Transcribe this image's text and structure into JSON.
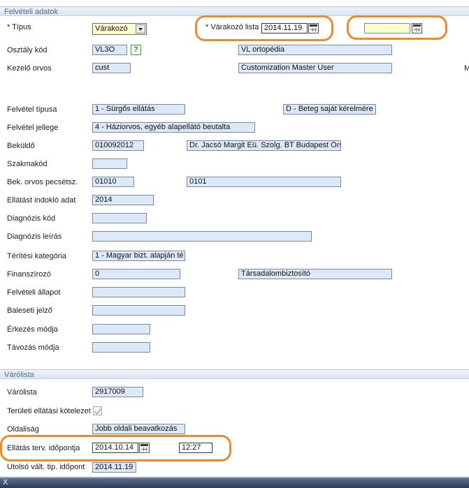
{
  "sections": {
    "felveteli_adatok": "Felvételi adatok",
    "varolista": "Várólista"
  },
  "fields": {
    "tipus": {
      "label": "* Típus",
      "value": "Várakozó"
    },
    "varakozo_lista": {
      "label": "* Várakozó lista",
      "date_from": "2014.11.19",
      "date_to": ""
    },
    "osztaly_kod": {
      "label": "Osztály kód",
      "code": "VL3O",
      "help": "?",
      "name": "VL ortopédia"
    },
    "kezelo_orvos": {
      "label": "Kezelő orvos",
      "code": "cust",
      "name": "Customization Master User",
      "extra": "M"
    },
    "felvetel_tipusa": {
      "label": "Felvétel típusa",
      "value": "1 - Sürgős ellátás",
      "secondary": "D - Beteg saját kérelmére -"
    },
    "felvetel_jellege": {
      "label": "Felvétel jellege",
      "value": "4 - Háziorvos, egyéb alapellátó beutalta"
    },
    "bekuldo": {
      "label": "Beküldő",
      "code": "010092012",
      "name": "Dr. Jacsó Margit Eü. Szolg. BT Budapest Örs"
    },
    "szakmakod": {
      "label": "Szakmakód",
      "value": ""
    },
    "bek_orvos": {
      "label": "Bek. orvos pecsétsz.",
      "code": "01010",
      "name": "0101"
    },
    "ellatast_indoklo": {
      "label": "Ellátást indokló adat",
      "value": "2014"
    },
    "diagnozis_kod": {
      "label": "Diagnózis kód",
      "value": ""
    },
    "diagnozis_leiras": {
      "label": "Diagnózis leírás",
      "value": ""
    },
    "teritesi_kategoria": {
      "label": "Térítési kategória",
      "value": "1 - Magyar bizt. alapján té"
    },
    "finanszirozo": {
      "label": "Finanszírozó",
      "code": "0",
      "name": "Társadalombiztosító"
    },
    "felveteli_allapot": {
      "label": "Felvételi állapot",
      "value": ""
    },
    "baleseti_jelzo": {
      "label": "Baleseti jelző",
      "value": ""
    },
    "erkezes_modja": {
      "label": "Érkezés módja",
      "value": ""
    },
    "tavozas_modja": {
      "label": "Távozás módja",
      "value": ""
    },
    "varolista_szam": {
      "label": "Várólista",
      "value": "2917009"
    },
    "teruleti_ellatasi": {
      "label": "Területi ellátási kötelezet"
    },
    "oldalisag": {
      "label": "Oldaliság",
      "value": "Jobb oldali beavatkozás"
    },
    "ellatas_terv": {
      "label": "Ellátás terv. időpontja",
      "date": "2014.10.14",
      "time": "12:27"
    },
    "utolso_valt": {
      "label": "Utolsó vált. tip. időpont",
      "value": "2014.11.19"
    }
  },
  "footer": {
    "text": "X"
  },
  "colors": {
    "highlight": "#f0882c",
    "field_bg": "#dde9f8",
    "section_text": "#54698a"
  }
}
